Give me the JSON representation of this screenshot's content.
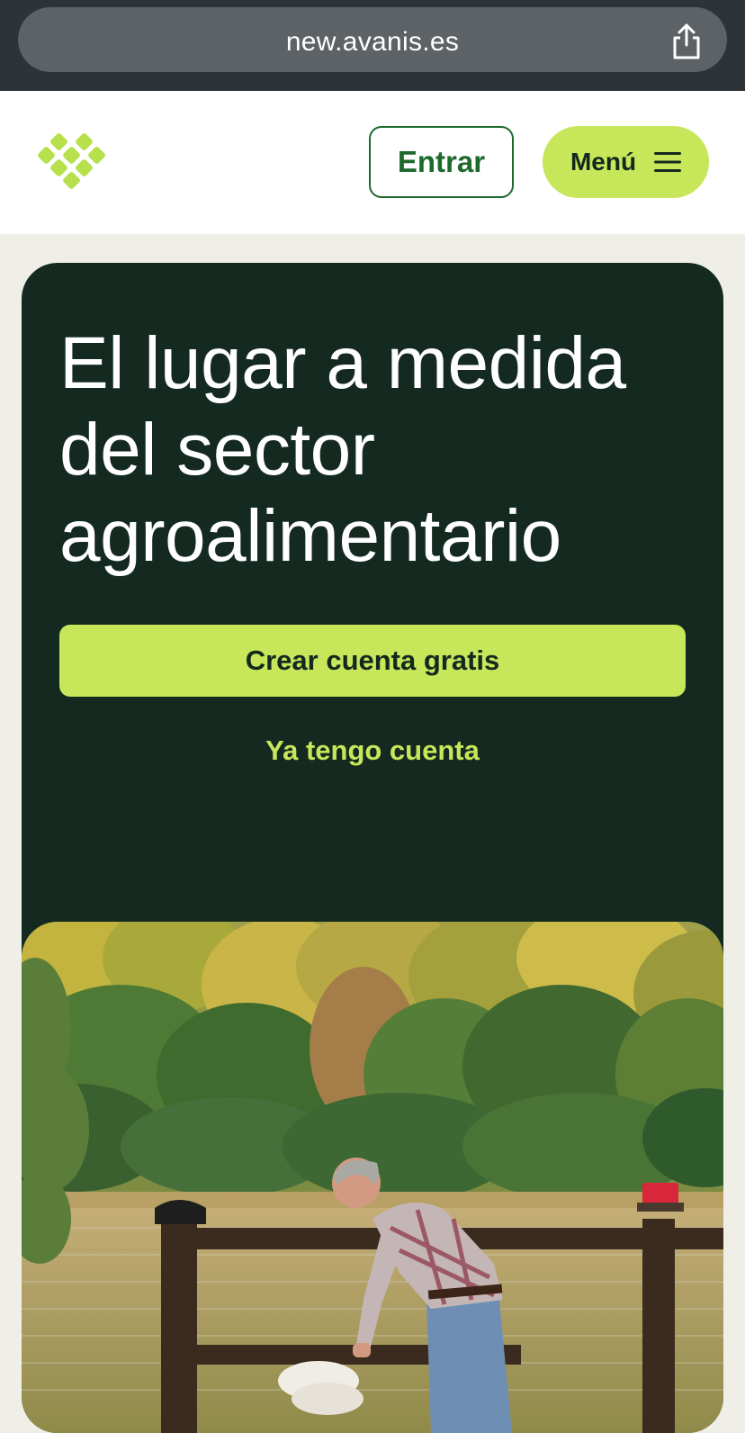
{
  "browser": {
    "url": "new.avanis.es",
    "share_icon": "share-icon"
  },
  "header": {
    "logo_icon": "avanis-diamond-logo",
    "login_label": "Entrar",
    "menu_label": "Menú",
    "menu_icon": "hamburger-icon"
  },
  "hero": {
    "title": "El lugar a medida del sector agroalimentario",
    "primary_cta": "Crear cuenta gratis",
    "secondary_cta": "Ya tengo cuenta",
    "image_icon": "farmer-feeding-lamb-photo"
  },
  "colors": {
    "brand_dark": "#142a20",
    "accent_lime": "#c7e65a",
    "accent_green": "#1d6a2c",
    "page_bg": "#efefe8"
  }
}
